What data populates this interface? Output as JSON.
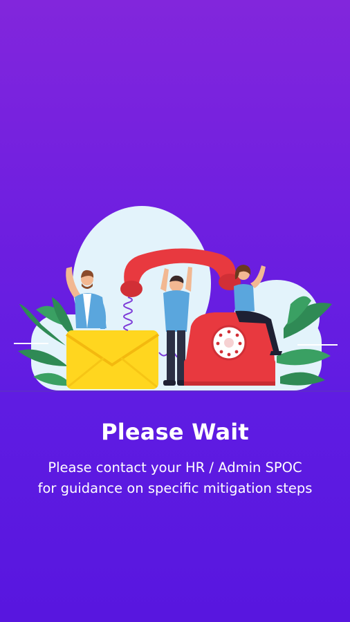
{
  "screen": {
    "title": "Please Wait",
    "message_line_1": "Please contact your HR / Admin SPOC",
    "message_line_2": "for guidance on specific mitigation steps"
  },
  "colors": {
    "background_top": "#8226dc",
    "background_bottom": "#5816df",
    "text": "#ffffff",
    "accent_red": "#e8393f",
    "envelope_yellow": "#ffd61f",
    "leaf_green": "#2f8a55",
    "circle_bg": "#e3f3fb"
  },
  "illustration": {
    "icons": [
      "envelope-icon",
      "rotary-telephone-icon",
      "telephone-handset-icon",
      "plant-leaves-icon"
    ]
  }
}
